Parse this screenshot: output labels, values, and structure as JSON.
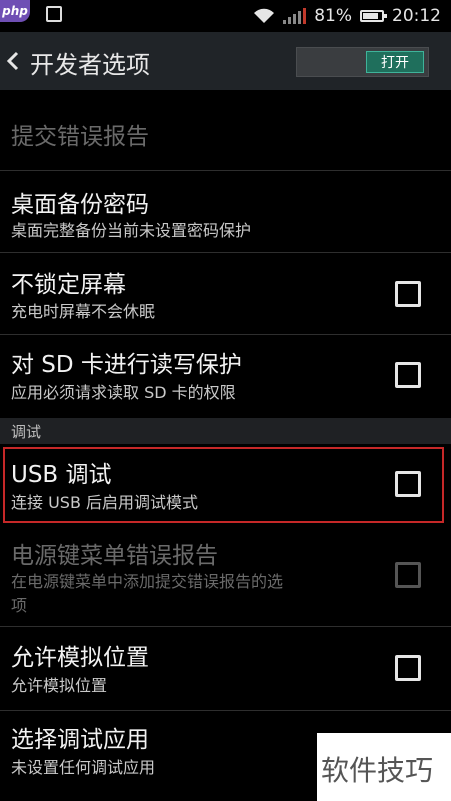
{
  "status_bar": {
    "logo_text": "php",
    "battery_percent": "81%",
    "battery_level": 0.81,
    "time": "20:12"
  },
  "action_bar": {
    "title": "开发者选项",
    "toggle_label": "打开"
  },
  "items": {
    "bug_report": {
      "title": "提交错误报告"
    },
    "desktop_backup_password": {
      "title": "桌面备份密码",
      "summary": "桌面完整备份当前未设置密码保护"
    },
    "stay_awake": {
      "title": "不锁定屏幕",
      "summary": "充电时屏幕不会休眠",
      "checked": false
    },
    "protect_sd": {
      "title": "对 SD 卡进行读写保护",
      "summary": "应用必须请求读取 SD 卡的权限",
      "checked": false
    },
    "usb_debugging": {
      "title": "USB 调试",
      "summary": "连接 USB 后启用调试模式",
      "checked": false
    },
    "power_menu_bug_report": {
      "title": "电源键菜单错误报告",
      "summary_line1": "在电源键菜单中添加提交错误报告的选",
      "summary_line2": "项",
      "checked": false
    },
    "mock_location": {
      "title": "允许模拟位置",
      "summary": "允许模拟位置",
      "checked": false
    },
    "debug_app": {
      "title": "选择调试应用",
      "summary": "未设置任何调试应用"
    }
  },
  "section": {
    "debugging_header": "调试"
  },
  "watermark": {
    "text": "软件技巧"
  },
  "colors": {
    "background": "#000000",
    "action_bar": "#202428",
    "toggle_on": "#1f6f5c",
    "highlight_border": "#c62828"
  }
}
